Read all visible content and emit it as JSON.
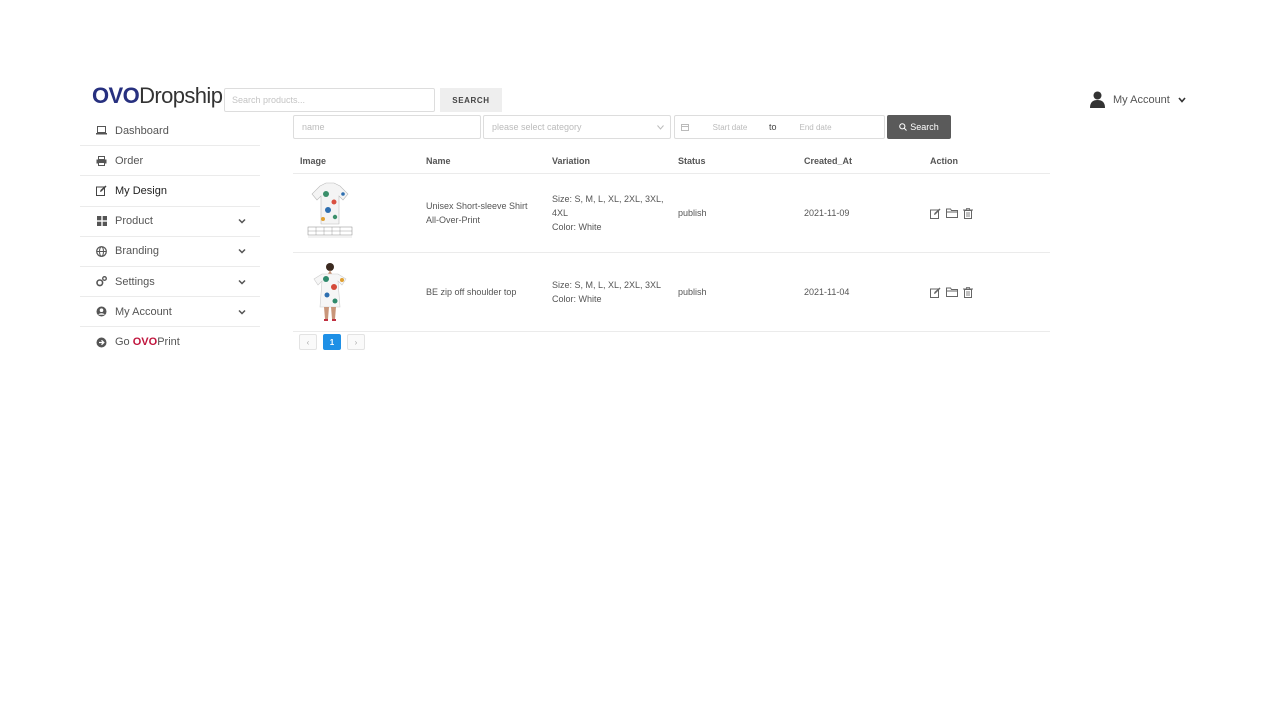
{
  "header": {
    "logo_part1": "OVO",
    "logo_part2": "Dropship",
    "search_placeholder": "Search products...",
    "search_button": "SEARCH",
    "account_label": "My Account"
  },
  "sidebar": {
    "items": [
      {
        "label": "Dashboard",
        "icon": "laptop-icon",
        "expandable": false
      },
      {
        "label": "Order",
        "icon": "printer-icon",
        "expandable": false
      },
      {
        "label": "My Design",
        "icon": "edit-icon",
        "expandable": false,
        "active": true
      },
      {
        "label": "Product",
        "icon": "grid-icon",
        "expandable": true
      },
      {
        "label": "Branding",
        "icon": "globe-icon",
        "expandable": true
      },
      {
        "label": "Settings",
        "icon": "gears-icon",
        "expandable": true
      },
      {
        "label": "My Account",
        "icon": "user-circle-icon",
        "expandable": true
      }
    ],
    "go_prefix": "Go ",
    "go_brand": "OVO",
    "go_suffix": "Print"
  },
  "filters": {
    "name_placeholder": "name",
    "category_placeholder": "please select category",
    "start_placeholder": "Start date",
    "to_label": "to",
    "end_placeholder": "End date",
    "search_label": "Search"
  },
  "table": {
    "headers": {
      "image": "Image",
      "name": "Name",
      "variation": "Variation",
      "status": "Status",
      "created": "Created_At",
      "action": "Action"
    },
    "rows": [
      {
        "name": "Unisex Short-sleeve Shirt All-Over-Print",
        "size": "Size: S, M, L, XL, 2XL, 3XL, 4XL",
        "color": "Color: White",
        "status": "publish",
        "created": "2021-11-09"
      },
      {
        "name": "BE zip off shoulder top",
        "size": "Size: S, M, L, XL, 2XL, 3XL",
        "color": "Color: White",
        "status": "publish",
        "created": "2021-11-04"
      }
    ]
  },
  "pagination": {
    "prev": "‹",
    "current": "1",
    "next": "›"
  },
  "colors": {
    "brand": "#27307f",
    "go_brand": "#c0143c",
    "search_button": "#5a5a5a",
    "page_active": "#1e90e6"
  }
}
